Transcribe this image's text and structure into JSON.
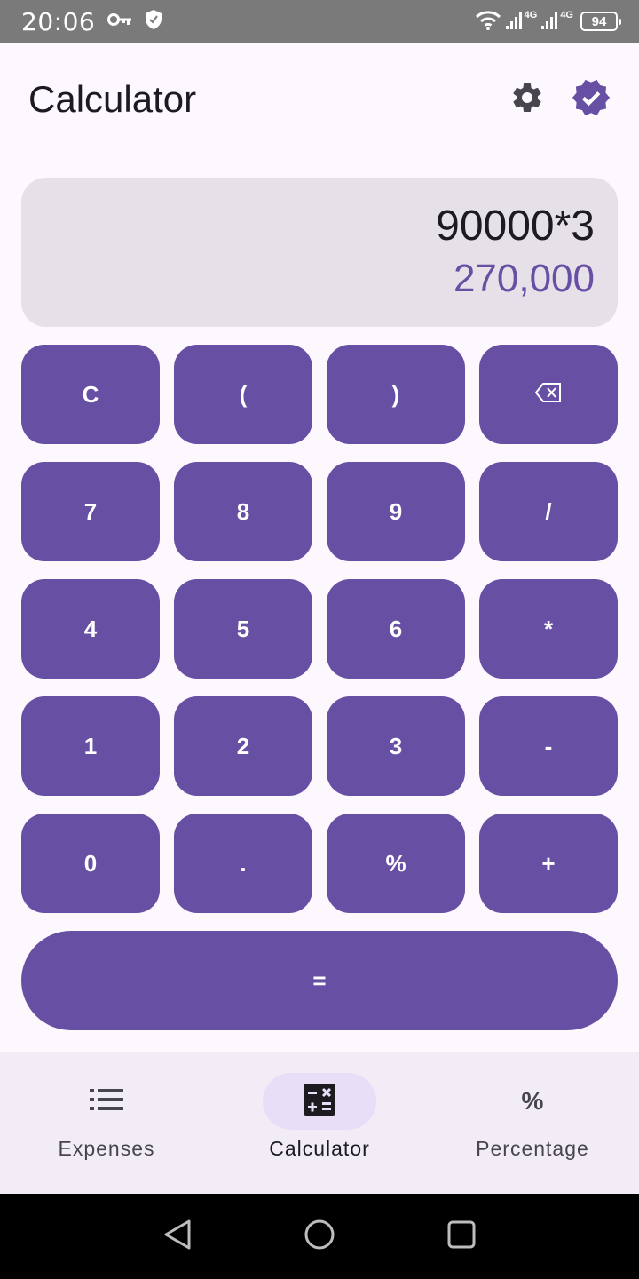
{
  "status_bar": {
    "time": "20:06",
    "net_tag_1": "4G",
    "net_tag_2": "4G",
    "battery": "94"
  },
  "app_bar": {
    "title": "Calculator",
    "settings_icon": "gear-icon",
    "verified_icon": "verified-badge-icon"
  },
  "display": {
    "expression": "90000*3",
    "result": "270,000"
  },
  "keypad": {
    "rows": [
      [
        "C",
        "(",
        ")",
        "⌫"
      ],
      [
        "7",
        "8",
        "9",
        "/"
      ],
      [
        "4",
        "5",
        "6",
        "*"
      ],
      [
        "1",
        "2",
        "3",
        "-"
      ],
      [
        "0",
        ".",
        "%",
        "+"
      ]
    ],
    "equals": "="
  },
  "bottom_nav": {
    "items": [
      {
        "label": "Expenses",
        "icon": "list-icon"
      },
      {
        "label": "Calculator",
        "icon": "calculator-icon",
        "active": true
      },
      {
        "label": "Percentage",
        "icon": "percent-icon",
        "glyph": "%"
      }
    ]
  },
  "colors": {
    "primary": "#6750A4",
    "surface": "#FDF7FE",
    "display_bg": "#E6E0E9",
    "nav_bg": "#F2ECF6",
    "active_indicator": "#E8DEF8"
  }
}
